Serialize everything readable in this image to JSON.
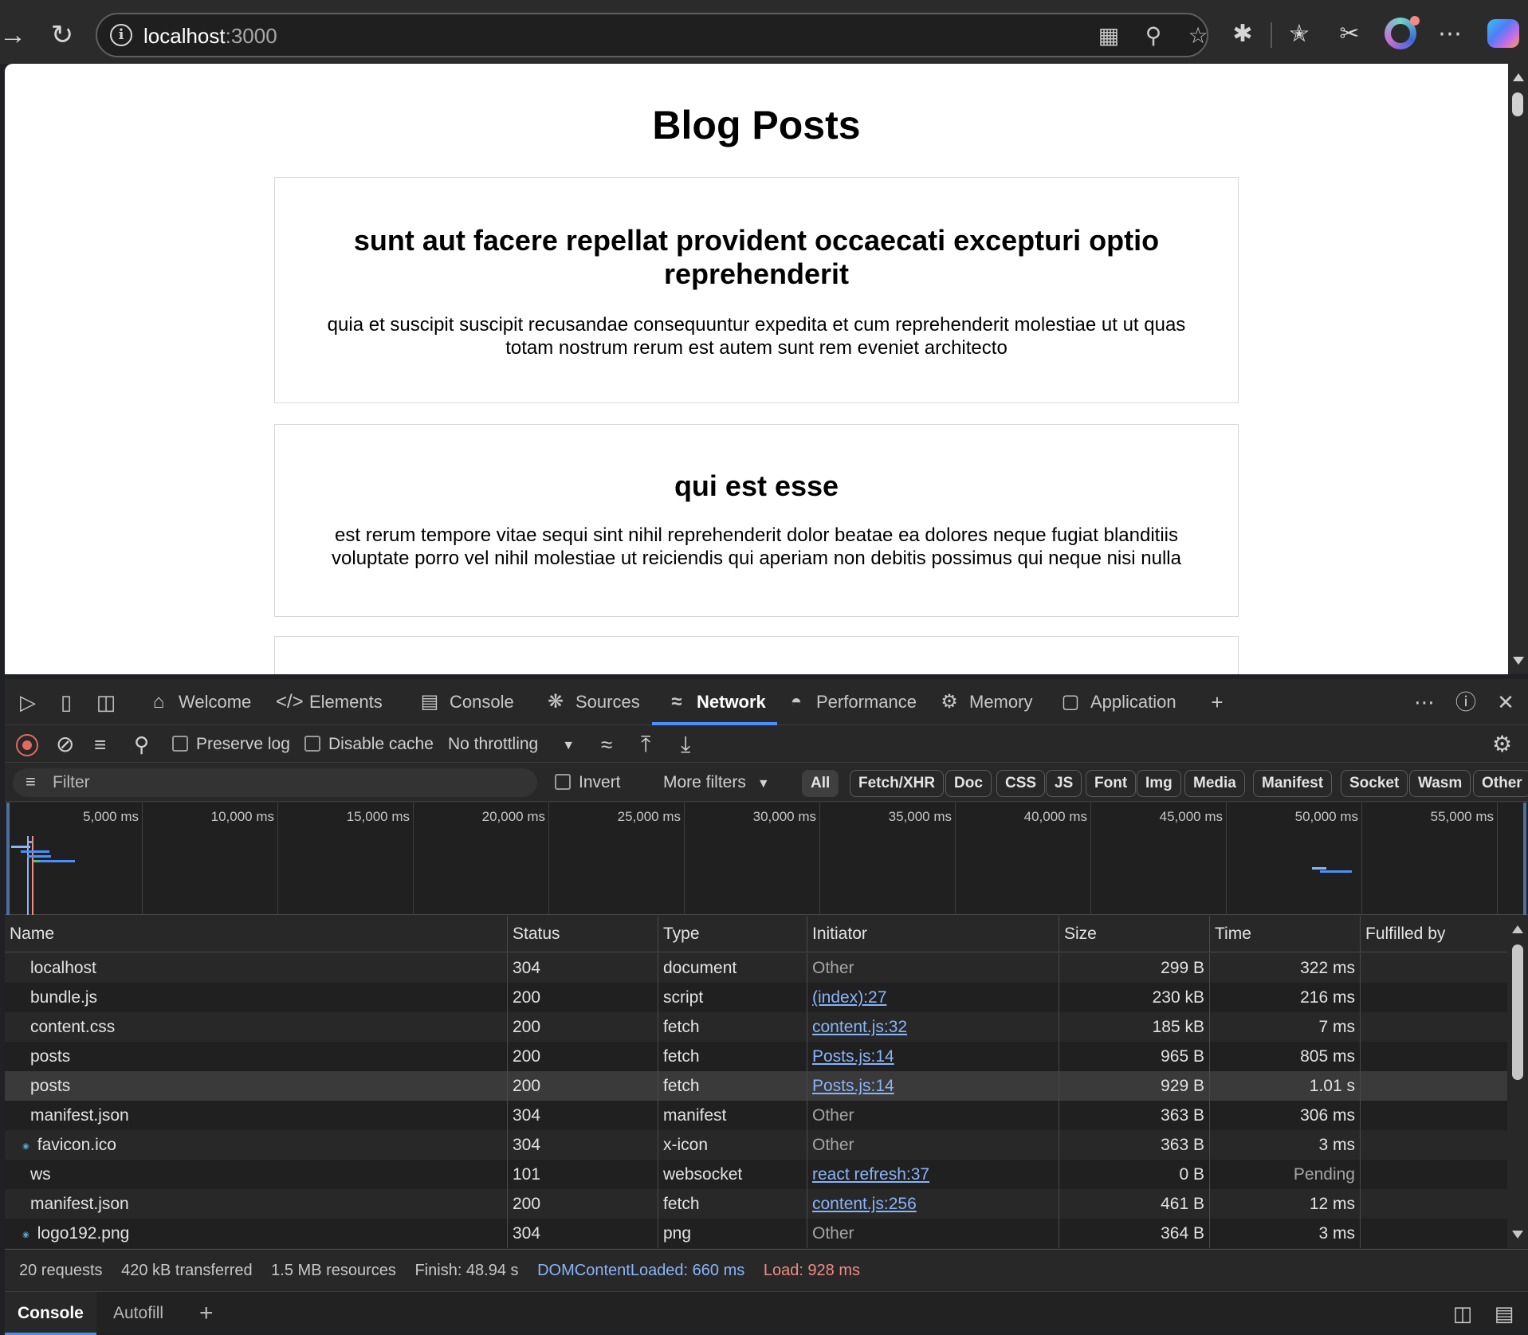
{
  "browser": {
    "url_host": "localhost",
    "url_port": ":3000",
    "icons": {
      "forward": "forward-arrow-icon",
      "refresh": "refresh-icon",
      "info": "site-info-icon",
      "app": "app-available-icon",
      "zoom": "zoom-out-icon",
      "favorite": "favorite-star-icon",
      "extensions": "extensions-icon",
      "favorites": "favorites-icon",
      "screenshot": "screenshot-icon",
      "more": "more-icon",
      "copilot": "copilot-icon"
    }
  },
  "page": {
    "title": "Blog Posts",
    "posts": [
      {
        "title": "sunt aut facere repellat provident occaecati excepturi optio reprehenderit",
        "body": "quia et suscipit suscipit recusandae consequuntur expedita et cum reprehenderit molestiae ut ut quas totam nostrum rerum est autem sunt rem eveniet architecto"
      },
      {
        "title": "qui est esse",
        "body": "est rerum tempore vitae sequi sint nihil reprehenderit dolor beatae ea dolores neque fugiat blanditiis voluptate porro vel nihil molestiae ut reiciendis qui aperiam non debitis possimus qui neque nisi nulla"
      }
    ]
  },
  "devtools": {
    "tabs": [
      {
        "label": "Welcome",
        "icon": "home-icon"
      },
      {
        "label": "Elements",
        "icon": "code-icon"
      },
      {
        "label": "Console",
        "icon": "console-icon"
      },
      {
        "label": "Sources",
        "icon": "bug-icon"
      },
      {
        "label": "Network",
        "icon": "wifi-icon",
        "active": true
      },
      {
        "label": "Performance",
        "icon": "gauge-icon"
      },
      {
        "label": "Memory",
        "icon": "chip-icon"
      },
      {
        "label": "Application",
        "icon": "window-icon"
      }
    ],
    "toolbar": {
      "preserve_log": "Preserve log",
      "disable_cache": "Disable cache",
      "throttling": "No throttling"
    },
    "filter": {
      "placeholder": "Filter",
      "invert": "Invert",
      "more_filters": "More filters",
      "chips": [
        "All",
        "Fetch/XHR",
        "Doc",
        "CSS",
        "JS",
        "Font",
        "Img",
        "Media",
        "Manifest",
        "Socket",
        "Wasm",
        "Other"
      ]
    },
    "timeline_ticks": [
      "5,000 ms",
      "10,000 ms",
      "15,000 ms",
      "20,000 ms",
      "25,000 ms",
      "30,000 ms",
      "35,000 ms",
      "40,000 ms",
      "45,000 ms",
      "50,000 ms",
      "55,000 ms"
    ],
    "columns": [
      "Name",
      "Status",
      "Type",
      "Initiator",
      "Size",
      "Time",
      "Fulfilled by"
    ],
    "requests": [
      {
        "name": "localhost",
        "status": "304",
        "type": "document",
        "initiator": "Other",
        "initiator_link": false,
        "size": "299 B",
        "time": "322 ms",
        "icon": false
      },
      {
        "name": "bundle.js",
        "status": "200",
        "type": "script",
        "initiator": "(index):27",
        "initiator_link": true,
        "size": "230 kB",
        "time": "216 ms",
        "icon": false
      },
      {
        "name": "content.css",
        "status": "200",
        "type": "fetch",
        "initiator": "content.js:32",
        "initiator_link": true,
        "size": "185 kB",
        "time": "7 ms",
        "icon": false
      },
      {
        "name": "posts",
        "status": "200",
        "type": "fetch",
        "initiator": "Posts.js:14",
        "initiator_link": true,
        "size": "965 B",
        "time": "805 ms",
        "icon": false
      },
      {
        "name": "posts",
        "status": "200",
        "type": "fetch",
        "initiator": "Posts.js:14",
        "initiator_link": true,
        "size": "929 B",
        "time": "1.01 s",
        "icon": false,
        "selected": true
      },
      {
        "name": "manifest.json",
        "status": "304",
        "type": "manifest",
        "initiator": "Other",
        "initiator_link": false,
        "size": "363 B",
        "time": "306 ms",
        "icon": false
      },
      {
        "name": "favicon.ico",
        "status": "304",
        "type": "x-icon",
        "initiator": "Other",
        "initiator_link": false,
        "size": "363 B",
        "time": "3 ms",
        "icon": true
      },
      {
        "name": "ws",
        "status": "101",
        "type": "websocket",
        "initiator": "react refresh:37",
        "initiator_link": true,
        "size": "0 B",
        "time": "Pending",
        "icon": false,
        "time_muted": true
      },
      {
        "name": "manifest.json",
        "status": "200",
        "type": "fetch",
        "initiator": "content.js:256",
        "initiator_link": true,
        "size": "461 B",
        "time": "12 ms",
        "icon": false
      },
      {
        "name": "logo192.png",
        "status": "304",
        "type": "png",
        "initiator": "Other",
        "initiator_link": false,
        "size": "364 B",
        "time": "3 ms",
        "icon": true
      }
    ],
    "summary": {
      "requests": "20 requests",
      "transferred": "420 kB transferred",
      "resources": "1.5 MB resources",
      "finish": "Finish: 48.94 s",
      "dcl": "DOMContentLoaded: 660 ms",
      "load": "Load: 928 ms"
    },
    "drawer_tabs": [
      "Console",
      "Autofill"
    ],
    "colors": {
      "accent": "#4c8ffb",
      "link": "#8ab4f8",
      "load": "#f28b82",
      "record": "#e46962"
    }
  }
}
